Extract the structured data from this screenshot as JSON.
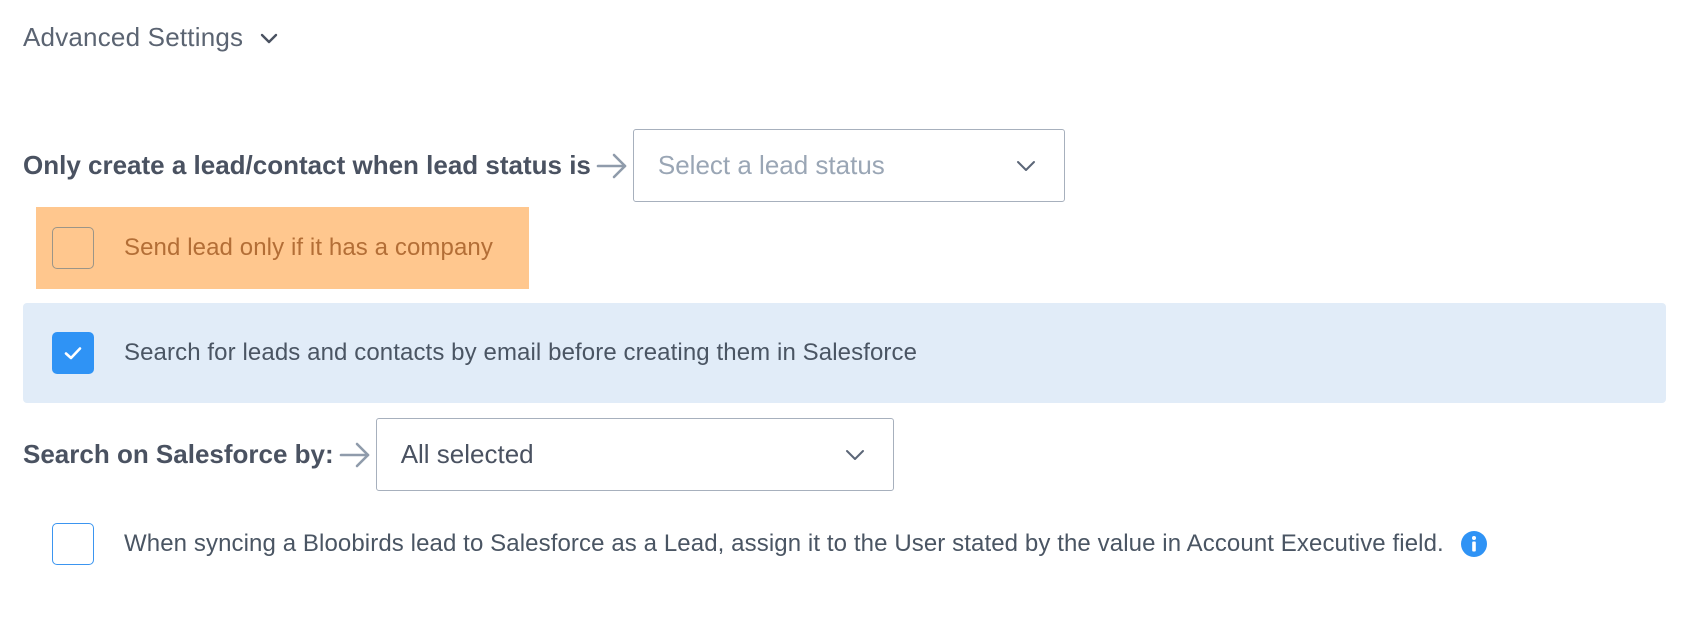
{
  "advanced_settings": {
    "title": "Advanced Settings",
    "toggle_icon": "chevron-down-icon"
  },
  "lead_status": {
    "label": "Only create a lead/contact when lead status is",
    "arrow_icon": "arrow-right-icon",
    "select_placeholder": "Select a lead status"
  },
  "company_option": {
    "label": "Send lead only if it has a company",
    "checked": false,
    "highlight_color": "#ffc78e"
  },
  "email_search_option": {
    "label": "Search for leads and contacts by email before creating them in Salesforce",
    "checked": true,
    "background_color": "#e1ecf8"
  },
  "search_by": {
    "label": "Search on Salesforce by:",
    "arrow_icon": "arrow-right-icon",
    "select_value": "All selected"
  },
  "assign_option": {
    "label": "When syncing a Bloobirds lead to Salesforce as a Lead, assign it to the User stated by the value in Account Executive field.",
    "checked": false,
    "info_icon": "info-icon"
  },
  "colors": {
    "accent": "#2f93f5",
    "text": "#4a5563",
    "placeholder": "#9aa6b5"
  }
}
